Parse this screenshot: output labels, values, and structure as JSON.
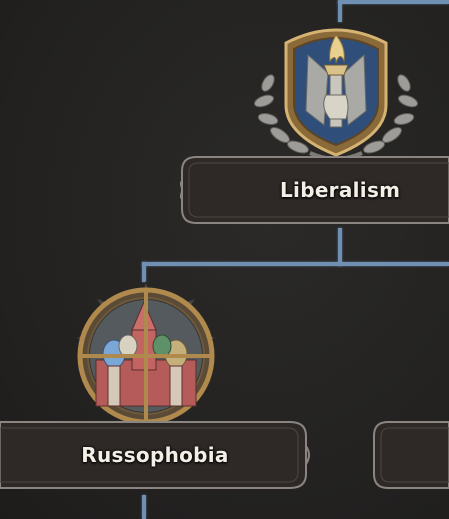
{
  "focus_tree": {
    "nodes": [
      {
        "id": "liberalism",
        "label": "Liberalism",
        "icon": "liberty-torch-icon"
      },
      {
        "id": "russophobia",
        "label": "Russophobia",
        "icon": "kremlin-crosshair-icon"
      },
      {
        "id": "unnamed-right",
        "label": ""
      }
    ]
  },
  "colors": {
    "background": "#252422",
    "connector": "#6f8fb3",
    "banner_fill": "#2e2826",
    "banner_border": "#8a8580",
    "label_text": "#f3efe6",
    "gold_frame": "#b08a4c",
    "blue_shield": "#2f4f7a"
  }
}
